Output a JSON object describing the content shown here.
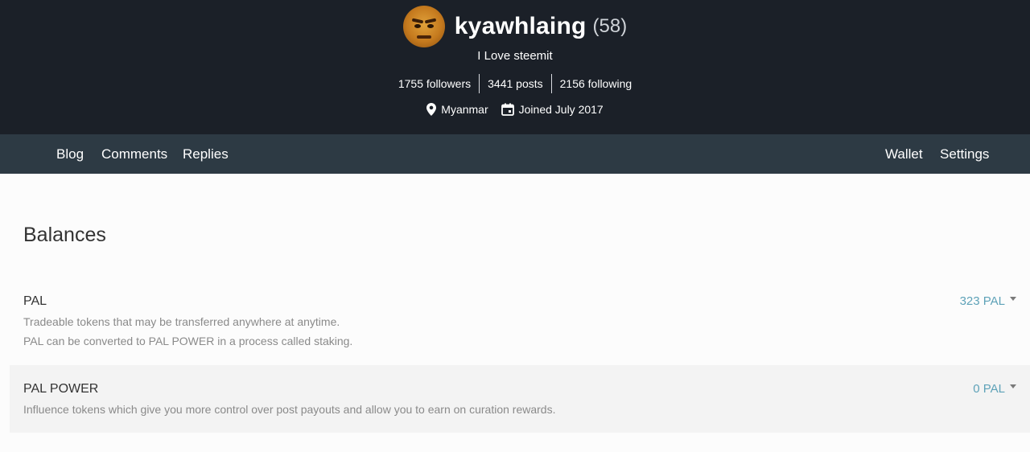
{
  "profile": {
    "username": "kyawhlaing",
    "reputation": "(58)",
    "about": "I Love steemit",
    "stats": [
      {
        "label": "1755 followers"
      },
      {
        "label": "3441 posts"
      },
      {
        "label": "2156 following"
      }
    ],
    "location": "Myanmar",
    "joined": "Joined July 2017",
    "icons": {
      "location": "location-pin-icon",
      "joined": "calendar-icon",
      "avatar": "user-avatar"
    }
  },
  "nav": {
    "left": [
      {
        "label": "Blog"
      },
      {
        "label": "Comments"
      },
      {
        "label": "Replies"
      }
    ],
    "right": [
      {
        "label": "Wallet"
      },
      {
        "label": "Settings"
      }
    ]
  },
  "balances": {
    "title": "Balances",
    "items": [
      {
        "name": "PAL",
        "description": [
          "Tradeable tokens that may be transferred anywhere at anytime.",
          "PAL can be converted to PAL POWER in a process called staking."
        ],
        "value": "323 PAL"
      },
      {
        "name": "PAL POWER",
        "description": [
          "Influence tokens which give you more control over post payouts and allow you to earn on curation rewards."
        ],
        "value": "0 PAL"
      }
    ]
  },
  "colors": {
    "header_bg": "#1b2028",
    "nav_bg": "#2d3a44",
    "value_link": "#5ea2b8",
    "alt_row_bg": "#f3f3f3"
  }
}
